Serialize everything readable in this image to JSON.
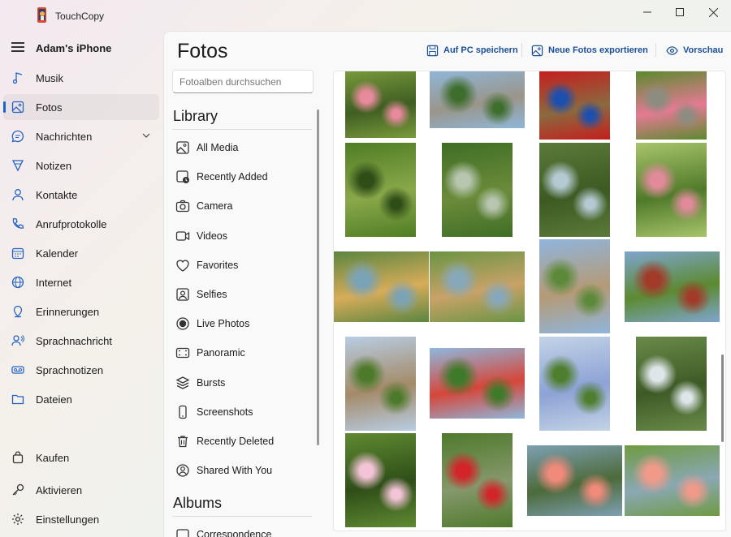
{
  "window": {
    "title": "TouchCopy"
  },
  "sidebar": {
    "device_name": "Adam's iPhone",
    "items": [
      {
        "label": "Musik",
        "icon": "music-icon"
      },
      {
        "label": "Fotos",
        "icon": "photo-icon",
        "selected": true
      },
      {
        "label": "Nachrichten",
        "icon": "message-icon",
        "expandable": true
      },
      {
        "label": "Notizen",
        "icon": "note-icon"
      },
      {
        "label": "Kontakte",
        "icon": "contact-icon"
      },
      {
        "label": "Anrufprotokolle",
        "icon": "phone-icon"
      },
      {
        "label": "Kalender",
        "icon": "calendar-icon"
      },
      {
        "label": "Internet",
        "icon": "globe-icon"
      },
      {
        "label": "Erinnerungen",
        "icon": "reminder-icon"
      },
      {
        "label": "Sprachnachricht",
        "icon": "voicemail-user-icon"
      },
      {
        "label": "Sprachnotizen",
        "icon": "voice-memo-icon"
      },
      {
        "label": "Dateien",
        "icon": "folder-icon"
      }
    ],
    "bottom_items": [
      {
        "label": "Kaufen",
        "icon": "bag-icon"
      },
      {
        "label": "Aktivieren",
        "icon": "key-icon"
      },
      {
        "label": "Einstellungen",
        "icon": "gear-icon"
      }
    ]
  },
  "main": {
    "title": "Fotos",
    "toolbar": {
      "save_label": "Auf PC speichern",
      "export_label": "Neue Fotos exportieren",
      "preview_label": "Vorschau"
    },
    "search": {
      "placeholder": "Fotoalben durchsuchen"
    },
    "library": {
      "heading": "Library",
      "albums": [
        {
          "label": "All Media",
          "icon": "all-media-icon"
        },
        {
          "label": "Recently Added",
          "icon": "recently-added-icon"
        },
        {
          "label": "Camera",
          "icon": "camera-icon"
        },
        {
          "label": "Videos",
          "icon": "video-icon"
        },
        {
          "label": "Favorites",
          "icon": "heart-icon"
        },
        {
          "label": "Selfies",
          "icon": "selfie-icon"
        },
        {
          "label": "Live Photos",
          "icon": "live-photo-icon"
        },
        {
          "label": "Panoramic",
          "icon": "panorama-icon"
        },
        {
          "label": "Bursts",
          "icon": "bursts-icon"
        },
        {
          "label": "Screenshots",
          "icon": "screenshot-icon"
        },
        {
          "label": "Recently Deleted",
          "icon": "trash-icon"
        },
        {
          "label": "Shared With You",
          "icon": "shared-icon"
        }
      ]
    },
    "albums_section": {
      "heading": "Albums",
      "albums": [
        {
          "label": "Correspondence",
          "icon": "album-icon"
        }
      ]
    },
    "photos": [
      {
        "subject": "pink flowers railing",
        "colors": [
          "#7a9b3c",
          "#e88a9c",
          "#3f5e22"
        ]
      },
      {
        "subject": "dragon tree viewpoint",
        "colors": [
          "#8fb6d8",
          "#3e6e2e",
          "#9a958a"
        ]
      },
      {
        "subject": "red door thatched house",
        "colors": [
          "#c41e1e",
          "#1d4fae",
          "#8b6a3f"
        ]
      },
      {
        "subject": "garden stone wall",
        "colors": [
          "#5b8a2e",
          "#8c8c80",
          "#e57a94"
        ]
      },
      {
        "subject": "fern forest path",
        "colors": [
          "#4f7d24",
          "#2e4d17",
          "#8aa84a"
        ]
      },
      {
        "subject": "waterfall garden",
        "colors": [
          "#3f6e25",
          "#b8c6b0",
          "#6b8b3a"
        ]
      },
      {
        "subject": "pond with plants",
        "colors": [
          "#5c7a3a",
          "#b4c9d2",
          "#3c5a22"
        ]
      },
      {
        "subject": "palm path flowers",
        "colors": [
          "#a8c46a",
          "#e08a9a",
          "#4f7a2a"
        ]
      },
      {
        "subject": "lily pond bridge",
        "colors": [
          "#5b8540",
          "#7aa3b6",
          "#d7ac5a"
        ]
      },
      {
        "subject": "pond bridge",
        "colors": [
          "#6a9444",
          "#87a8b8",
          "#c9a268"
        ]
      },
      {
        "subject": "palm avenue",
        "colors": [
          "#8fb5dd",
          "#5d8a3a",
          "#b59a76"
        ]
      },
      {
        "subject": "red roof hut",
        "colors": [
          "#7ea5cf",
          "#a23a2a",
          "#5c8a30"
        ]
      },
      {
        "subject": "garden walkway",
        "colors": [
          "#b8cde4",
          "#4d7a2a",
          "#a48a68"
        ]
      },
      {
        "subject": "tropical shrubs",
        "colors": [
          "#8eb8de",
          "#3f7a2a",
          "#d6463a"
        ]
      },
      {
        "subject": "hydrangea path",
        "colors": [
          "#c3d3e6",
          "#4f7e2e",
          "#8da2d6"
        ]
      },
      {
        "subject": "fountain pond",
        "colors": [
          "#6a8a4a",
          "#dfe6ea",
          "#3d5a25"
        ]
      },
      {
        "subject": "pink lily",
        "colors": [
          "#5f8a32",
          "#f3c3d6",
          "#2f4e18"
        ]
      },
      {
        "subject": "red flower bed",
        "colors": [
          "#4e7a2c",
          "#d2252a",
          "#86986c"
        ]
      },
      {
        "subject": "flamingos pool",
        "colors": [
          "#7ea0b2",
          "#f08a7a",
          "#4c6a3a"
        ]
      },
      {
        "subject": "flamingos group",
        "colors": [
          "#6f9a42",
          "#f29a8a",
          "#8aa8b4"
        ]
      }
    ]
  }
}
